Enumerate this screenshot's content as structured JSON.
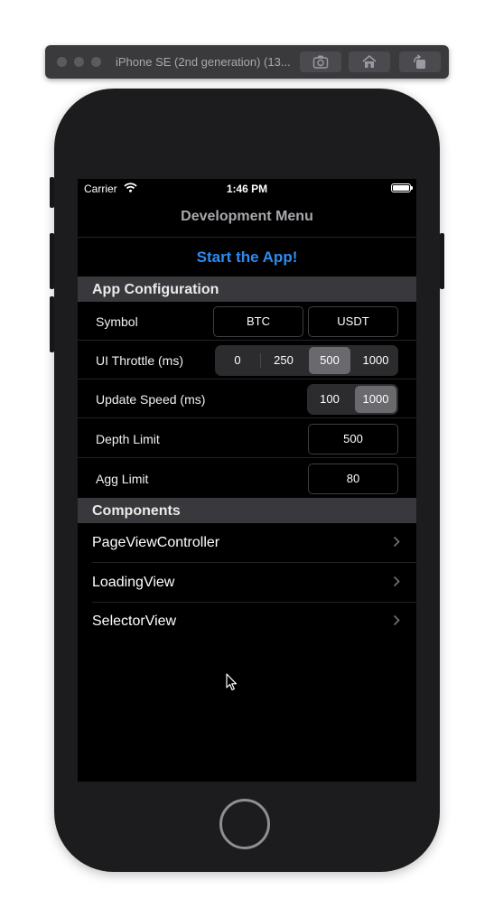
{
  "simulator": {
    "device_title": "iPhone SE (2nd generation) (13..."
  },
  "status_bar": {
    "carrier": "Carrier",
    "time": "1:46 PM"
  },
  "nav": {
    "title": "Development Menu"
  },
  "start_button": "Start the App!",
  "app_config": {
    "header": "App Configuration",
    "symbol": {
      "label": "Symbol",
      "base": "BTC",
      "quote": "USDT"
    },
    "ui_throttle": {
      "label": "UI Throttle (ms)",
      "options": [
        "0",
        "250",
        "500",
        "1000"
      ],
      "selected": "500"
    },
    "update_speed": {
      "label": "Update Speed (ms)",
      "options": [
        "100",
        "1000"
      ],
      "selected": "1000"
    },
    "depth_limit": {
      "label": "Depth Limit",
      "value": "500"
    },
    "agg_limit": {
      "label": "Agg Limit",
      "value": "80"
    }
  },
  "components": {
    "header": "Components",
    "items": [
      "PageViewController",
      "LoadingView",
      "SelectorView"
    ]
  },
  "colors": {
    "accent": "#2e8bf0",
    "section_bg": "#39393d",
    "phone_body": "#1c1c1e"
  }
}
